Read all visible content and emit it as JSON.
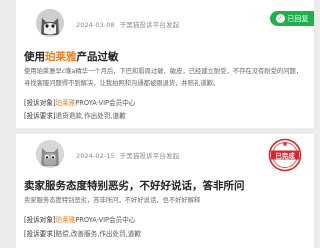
{
  "complaints": [
    {
      "date": "2024-03-08",
      "platform": "于黑猫投诉平台发起",
      "status": "已回复",
      "status_color": "#1fb24c",
      "title_hl": "珀莱雅",
      "title_prefix": "使用",
      "title_suffix": "产品过敏",
      "description": "使用珀莱雅早c晚a精华一个月后，下巴和唇周过敏、敏皮，已经建立耐受，不存在没有耐受的问题，寻找客服问题得不到解决，让我拍照和沟通都被跟退货，并赔礼道歉。",
      "object_label": "[投诉对象]",
      "object_hl": "珀莱雅",
      "object_rest": "PROYA-VIP会员中心",
      "request_label": "[投诉要求]",
      "request_value": "退货退款,作出处罚,道歉",
      "avatar_icon": "cat-avatar-icon"
    },
    {
      "date": "2024-02-15",
      "platform": "于黑猫投诉平台发起",
      "status": "已完成",
      "status_color": "#d8262d",
      "title": "卖家服务态度特别恶劣，不好好说话，答非所问",
      "description": "卖家服务态度特别恶劣，答非所问，不好好说话，也不好好解释",
      "object_label": "[投诉对象]",
      "object_hl": "珀莱雅",
      "object_rest": "PROYA-VIP会员中心",
      "request_label": "[投诉要求]",
      "request_value": "赔偿,改善服务,作出处罚,道歉",
      "avatar_icon": "cat-avatar-icon"
    }
  ]
}
